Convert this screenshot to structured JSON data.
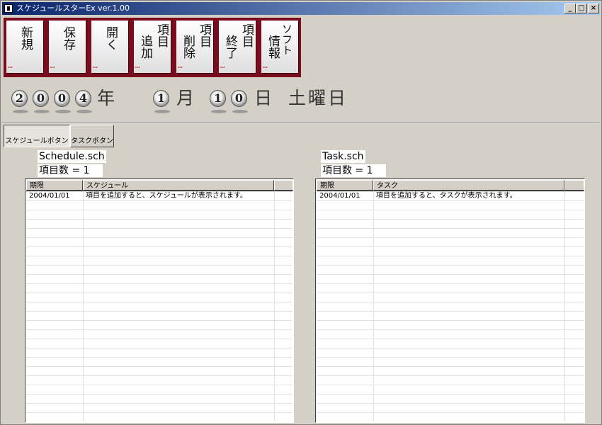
{
  "window": {
    "title": "スケジュールスターEx ver.1.00",
    "controls": {
      "minimize": "_",
      "maximize": "□",
      "close": "×"
    }
  },
  "toolbar": {
    "buttons": [
      {
        "name": "new-button",
        "line1": "新規",
        "line2": ""
      },
      {
        "name": "save-button",
        "line1": "保存",
        "line2": ""
      },
      {
        "name": "open-button",
        "line1": "開く",
        "line2": ""
      },
      {
        "name": "add-item-button",
        "line1": "項目",
        "line2": "追加"
      },
      {
        "name": "delete-item-button",
        "line1": "項目",
        "line2": "削除"
      },
      {
        "name": "finish-item-button",
        "line1": "項目",
        "line2": "終了"
      },
      {
        "name": "software-info-button",
        "line1": "ソフト",
        "line2": "情報"
      }
    ]
  },
  "date": {
    "year_digits": [
      "2",
      "0",
      "0",
      "4"
    ],
    "year_unit": "年",
    "month_digits": [
      "1"
    ],
    "month_unit": "月",
    "day_digits": [
      "1",
      "0"
    ],
    "day_unit": "日",
    "weekday": "土曜日"
  },
  "tabs": [
    {
      "label": "スケジュールボタン",
      "active": true
    },
    {
      "label": "タスクボタン",
      "active": false
    }
  ],
  "schedule": {
    "filename": "Schedule.sch",
    "count_text": "項目数 = 1",
    "columns": [
      "期限",
      "スケジュール",
      ""
    ],
    "rows": [
      {
        "deadline": "2004/01/01",
        "text": "項目を追加すると、スケジュールが表示されます。"
      }
    ]
  },
  "task": {
    "filename": "Task.sch",
    "count_text": "項目数 = 1",
    "columns": [
      "期限",
      "タスク",
      ""
    ],
    "rows": [
      {
        "deadline": "2004/01/01",
        "text": "項目を追加すると、タスクが表示されます。"
      }
    ]
  },
  "colors": {
    "titlebar_start": "#0a246a",
    "titlebar_end": "#a6caf0",
    "toolbar_bg": "#7a0c1e",
    "window_bg": "#d4d0c8"
  }
}
